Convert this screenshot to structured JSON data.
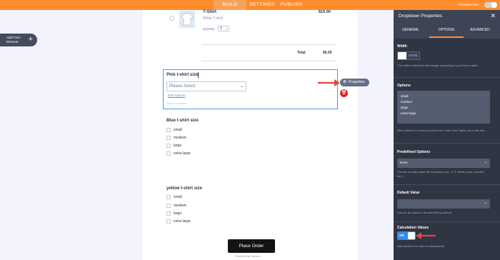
{
  "topbar": {
    "tabs": [
      "BUILD",
      "SETTINGS",
      "PUBLISH"
    ],
    "active_tab": "BUILD",
    "preview_label": "Preview Form"
  },
  "left": {
    "add_label_1": "Add Form",
    "add_label_2": "Element",
    "add_plus": "+"
  },
  "product": {
    "name": "T-Shirt",
    "subtitle": "White T-shirt",
    "price": "$10.00",
    "quantity_label": "Quantity",
    "quantity_value": "1",
    "total_label": "Total",
    "total_value": "$0.00"
  },
  "fields": {
    "pink": {
      "label": "Pink t-shirt size",
      "placeholder": "Please Select",
      "edit_options": "Edit Options",
      "sublabel": "Type a sublabel"
    },
    "blue": {
      "label": "Blue t-shirt size",
      "options": [
        "small",
        "medium",
        "large",
        "extra large"
      ]
    },
    "yellow": {
      "label": "yellow t-shirt size",
      "options": [
        "small",
        "medium",
        "large",
        "extra large"
      ]
    }
  },
  "properties_button": "Properties",
  "place_order": "Place Order",
  "powered_by": "Powered by Jotform",
  "panel": {
    "title": "Dropdown Properties",
    "close": "✕",
    "tabs": [
      "GENERAL",
      "OPTIONS",
      "ADVANCED"
    ],
    "active_tab": "OPTIONS",
    "width": {
      "title": "Width",
      "value": "AUTO",
      "desc": "The width of this field will change according to your form's width."
    },
    "options": {
      "title": "Options",
      "items": [
        "small",
        "medium",
        "large",
        "extra large"
      ],
      "desc": "Give options for users to select from. Enter each option on a new line."
    },
    "predefined": {
      "title": "Predefined Options",
      "value": "None",
      "desc": "Choose a ready-made list of options (e.g., U.S. states, days, months, etc.)"
    },
    "default_value": {
      "title": "Default Value",
      "value": "",
      "desc": "Choose an option to be selected by default"
    },
    "calculation": {
      "title": "Calculation Values",
      "state": "ON",
      "desc": "Add values to be used in calculations"
    }
  },
  "colors": {
    "accent": "#ff8d2e",
    "panel_bg": "#2f3542",
    "selected_border": "#4a9ae0",
    "delete": "#d8261e",
    "arrow": "#e4473f",
    "toggle_on": "#2f8be8"
  }
}
